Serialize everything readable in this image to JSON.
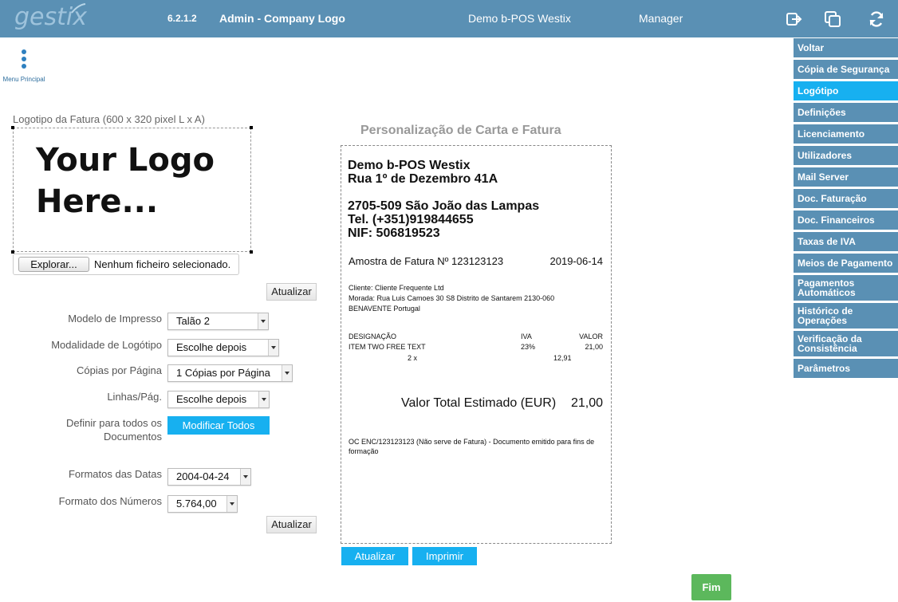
{
  "topbar": {
    "logo": "gestix",
    "version": "6.2.1.2",
    "screen_title": "Admin - Company Logo",
    "company": "Demo b-POS Westix",
    "user": "Manager",
    "icons": [
      "logout-icon",
      "copy-window-icon",
      "refresh-icon"
    ]
  },
  "menu_principal": {
    "label": "Menu Principal",
    "icon": "vertical-dots-icon"
  },
  "sidebar": {
    "items": [
      {
        "label": "Voltar",
        "active": false
      },
      {
        "label": "Cópia de Segurança",
        "active": false
      },
      {
        "label": "Logótipo",
        "active": true
      },
      {
        "label": "Definições",
        "active": false
      },
      {
        "label": "Licenciamento",
        "active": false
      },
      {
        "label": "Utilizadores",
        "active": false
      },
      {
        "label": "Mail Server",
        "active": false
      },
      {
        "label": "Doc. Faturação",
        "active": false
      },
      {
        "label": "Doc. Financeiros",
        "active": false
      },
      {
        "label": "Taxas de IVA",
        "active": false
      },
      {
        "label": "Meios de Pagamento",
        "active": false
      },
      {
        "label": "Pagamentos Automáticos",
        "active": false
      },
      {
        "label": "Histórico de Operações",
        "active": false
      },
      {
        "label": "Verificação da Consistência",
        "active": false
      },
      {
        "label": "Parâmetros",
        "active": false
      }
    ]
  },
  "logo_section": {
    "title": "Logotipo da Fatura (600 x 320 pixel L x A)",
    "placeholder_line1": "Your Logo",
    "placeholder_line2": "Here...",
    "browse_label": "Explorar...",
    "file_status": "Nenhum ficheiro selecionado.",
    "update_label": "Atualizar"
  },
  "form": {
    "modelo_label": "Modelo de Impresso",
    "modelo_value": "Talão 2",
    "modalidade_label": "Modalidade de Logótipo",
    "modalidade_value": "Escolhe depois",
    "copias_label": "Cópias por Página",
    "copias_value": "1 Cópias por Página",
    "linhas_label": "Linhas/Pág.",
    "linhas_value": "Escolhe depois",
    "definir_label_1": "Definir para todos os",
    "definir_label_2": "Documentos",
    "modificar_label": "Modificar Todos",
    "datas_label": "Formatos das Datas",
    "datas_value": "2004-04-24",
    "numeros_label": "Formato dos Números",
    "numeros_value": "5.764,00",
    "update_label": "Atualizar"
  },
  "preview": {
    "title": "Personalização de Carta e Fatura",
    "company_name": "Demo b-POS Westix",
    "address_1": "Rua 1º de Dezembro 41A",
    "address_2": "2705-509 São João das Lampas",
    "phone": "Tel. (+351)919844655",
    "nif": "NIF: 506819523",
    "invoice_label": "Amostra de Fatura Nº 123123123",
    "invoice_date": "2019-06-14",
    "client": "Cliente: Cliente Frequente Ltd",
    "morada": "Morada: Rua Luis Camoes 30 S8 Distrito de Santarem 2130-060",
    "city": "BENAVENTE Portugal",
    "col_designacao": "DESIGNAÇÃO",
    "col_iva": "IVA",
    "col_valor": "VALOR",
    "item_name": "ITEM TWO FREE TEXT",
    "item_iva": "23%",
    "item_valor": "21,00",
    "item_qty": "2 x",
    "item_unit": "12,91",
    "total_label": "Valor Total Estimado (EUR)",
    "total_value": "21,00",
    "footer_line1": "OC ENC/123123123 (Não serve de Fatura) - Documento emitido para fins de",
    "footer_line2": "formação",
    "update_label": "Atualizar",
    "print_label": "Imprimir"
  },
  "finish_label": "Fim"
}
